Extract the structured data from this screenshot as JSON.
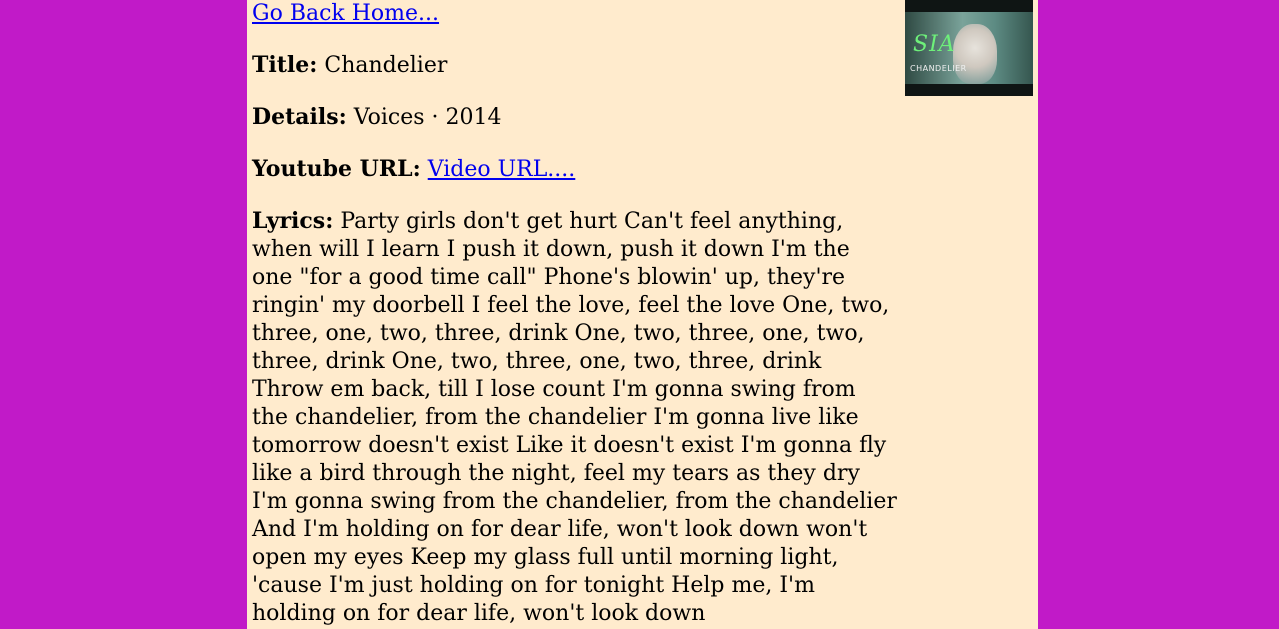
{
  "nav": {
    "back_link": "Go Back Home..."
  },
  "song": {
    "title_label": "Title:",
    "title": "Chandelier",
    "details_label": "Details:",
    "details": "Voices · 2014",
    "youtube_label": "Youtube URL:",
    "youtube_link": "Video URL....",
    "lyrics_label": "Lyrics:",
    "lyrics": "Party girls don't get hurt Can't feel anything, when will I learn I push it down, push it down I'm the one \"for a good time call\" Phone's blowin' up, they're ringin' my doorbell I feel the love, feel the love One, two, three, one, two, three, drink One, two, three, one, two, three, drink One, two, three, one, two, three, drink Throw em back, till I lose count I'm gonna swing from the chandelier, from the chandelier I'm gonna live like tomorrow doesn't exist Like it doesn't exist I'm gonna fly like a bird through the night, feel my tears as they dry I'm gonna swing from the chandelier, from the chandelier And I'm holding on for dear life, won't look down won't open my eyes Keep my glass full until morning light, 'cause I'm just holding on for tonight Help me, I'm holding on for dear life, won't look down"
  },
  "thumbnail": {
    "logo_text": "SIA",
    "caption": "CHANDELIER"
  },
  "colors": {
    "background": "#c11ac8",
    "panel": "#ffebcd",
    "link": "#0000ee"
  }
}
